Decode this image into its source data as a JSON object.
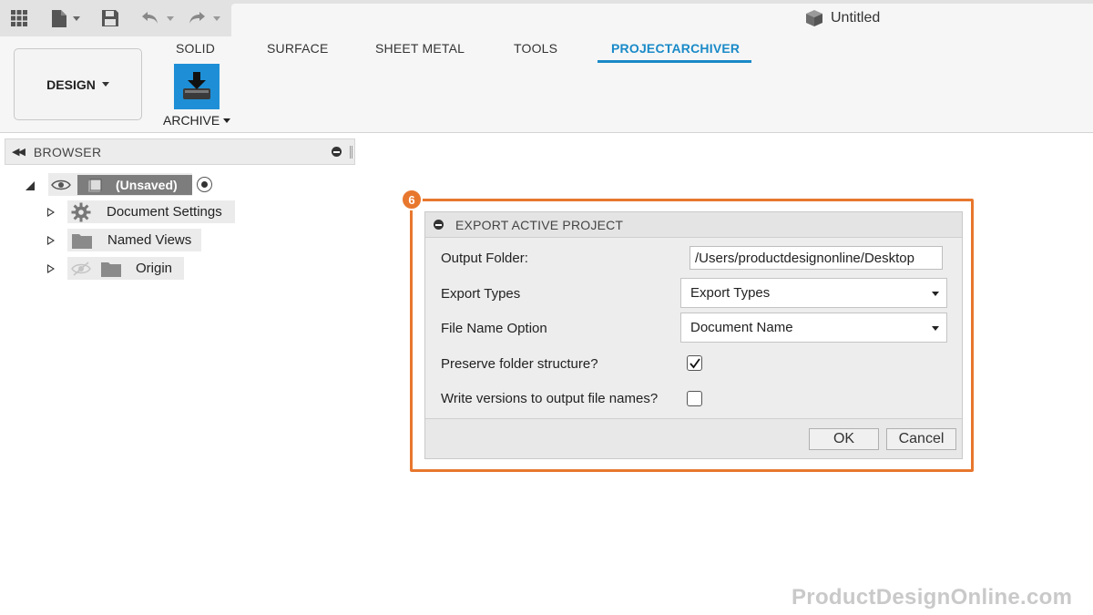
{
  "app": {
    "document_title": "Untitled"
  },
  "toolbar": {
    "icons": [
      "grid-icon",
      "file-icon",
      "save-icon",
      "undo-icon",
      "redo-icon"
    ]
  },
  "ribbon": {
    "workspace_label": "DESIGN",
    "tabs": [
      {
        "label": "SOLID",
        "active": false
      },
      {
        "label": "SURFACE",
        "active": false
      },
      {
        "label": "SHEET METAL",
        "active": false
      },
      {
        "label": "TOOLS",
        "active": false
      },
      {
        "label": "PROJECTARCHIVER",
        "active": true
      }
    ],
    "archive_label": "ARCHIVE",
    "accent_color": "#1a8ac8"
  },
  "browser": {
    "title": "BROWSER",
    "root_label": "(Unsaved)",
    "items": [
      {
        "label": "Document Settings",
        "icon": "gear-icon"
      },
      {
        "label": "Named Views",
        "icon": "folder-icon"
      },
      {
        "label": "Origin",
        "icon": "folder-icon"
      }
    ]
  },
  "callout": {
    "step_number": "6",
    "color": "#e8772e"
  },
  "dialog": {
    "title": "EXPORT ACTIVE PROJECT",
    "output_folder_label": "Output Folder:",
    "output_folder_value": "/Users/productdesignonline/Desktop",
    "export_types_label": "Export Types",
    "export_types_value": "Export Types",
    "file_name_option_label": "File Name Option",
    "file_name_option_value": "Document Name",
    "preserve_label": "Preserve folder structure?",
    "preserve_checked": true,
    "versions_label": "Write versions to output file names?",
    "versions_checked": false,
    "ok_label": "OK",
    "cancel_label": "Cancel"
  },
  "watermark": "ProductDesignOnline.com"
}
